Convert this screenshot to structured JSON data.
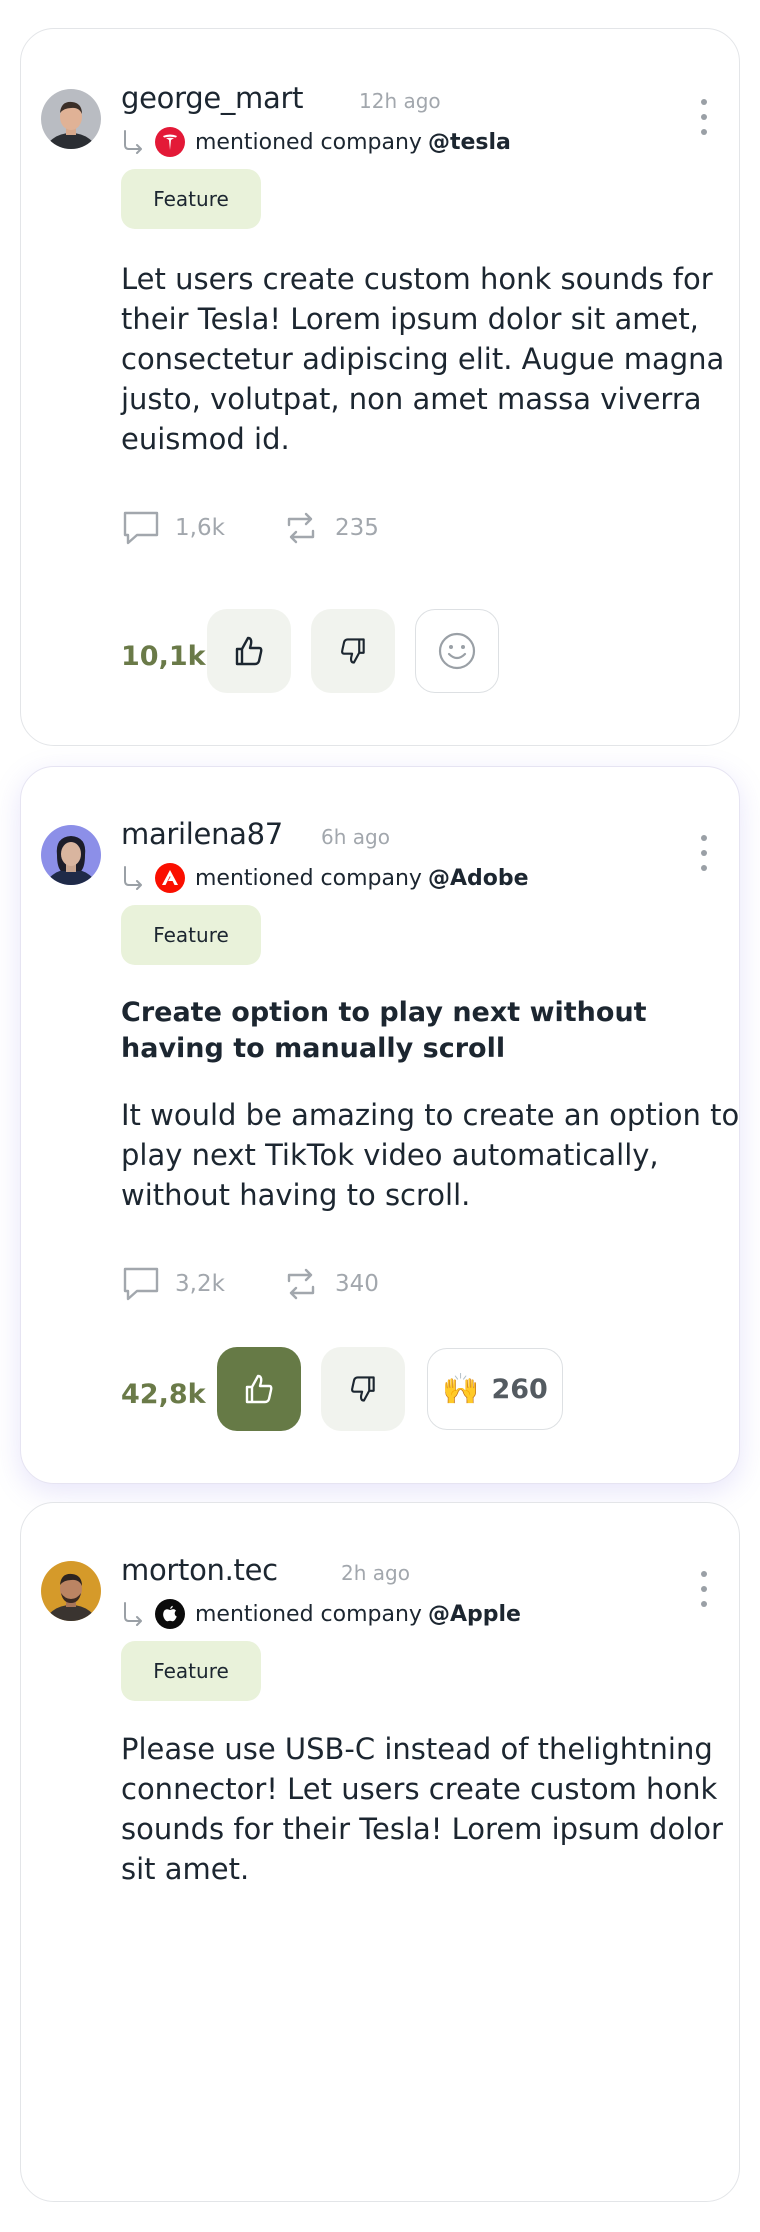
{
  "posts": [
    {
      "username": "george_mart",
      "time": "12h ago",
      "mention_prefix": "mentioned company",
      "company": "@tesla",
      "company_logo": "tesla-logo",
      "tag": "Feature",
      "title": "",
      "body": "Let users create custom honk sounds for their Tesla! Lorem ipsum dolor sit amet, consectetur adipiscing elit. Augue magna justo, volutpat, non amet massa viverra euismod id.",
      "comments": "1,6k",
      "reposts": "235",
      "votes": "10,1k",
      "upvote_active": false,
      "reaction_count": ""
    },
    {
      "username": "marilena87",
      "time": "6h ago",
      "mention_prefix": "mentioned company",
      "company": "@Adobe",
      "company_logo": "adobe-logo",
      "tag": "Feature",
      "title": "Create option to play next without having to manually scroll",
      "body": "It would be amazing to create an option to play next TikTok video automatically, without having to scroll.",
      "comments": "3,2k",
      "reposts": "340",
      "votes": "42,8k",
      "upvote_active": true,
      "reaction_emoji": "🙌",
      "reaction_count": "260"
    },
    {
      "username": "morton.tec",
      "time": "2h ago",
      "mention_prefix": "mentioned company",
      "company": "@Apple",
      "company_logo": "apple-logo",
      "tag": "Feature",
      "title": "",
      "body": "Please use  USB-C instead of thelightning connector! Let users create custom honk sounds for their Tesla! Lorem ipsum dolor sit amet."
    }
  ],
  "colors": {
    "tag_bg": "#e9f2da",
    "accent_green": "#667a46",
    "votes_text": "#6a7a48",
    "muted": "#a2a7ad"
  }
}
